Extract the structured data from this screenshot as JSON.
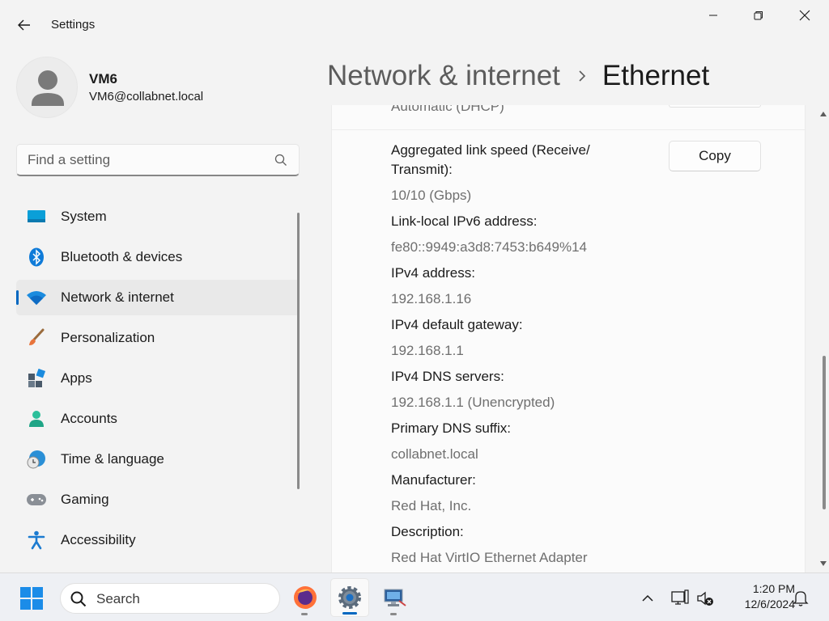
{
  "window": {
    "title": "Settings"
  },
  "user": {
    "name": "VM6",
    "email": "VM6@collabnet.local"
  },
  "search": {
    "placeholder": "Find a setting"
  },
  "nav": {
    "items": [
      {
        "label": "System",
        "icon": "system-icon",
        "active": false
      },
      {
        "label": "Bluetooth & devices",
        "icon": "bluetooth-icon",
        "active": false
      },
      {
        "label": "Network & internet",
        "icon": "wifi-icon",
        "active": true
      },
      {
        "label": "Personalization",
        "icon": "brush-icon",
        "active": false
      },
      {
        "label": "Apps",
        "icon": "apps-icon",
        "active": false
      },
      {
        "label": "Accounts",
        "icon": "accounts-icon",
        "active": false
      },
      {
        "label": "Time & language",
        "icon": "time-language-icon",
        "active": false
      },
      {
        "label": "Gaming",
        "icon": "gamepad-icon",
        "active": false
      },
      {
        "label": "Accessibility",
        "icon": "accessibility-icon",
        "active": false
      }
    ]
  },
  "header": {
    "parent": "Network & internet",
    "current": "Ethernet"
  },
  "properties": {
    "clipped_value": "Automatic (DHCP)",
    "copy_label": "Copy",
    "rows": [
      {
        "label": "Aggregated link speed (Receive/",
        "label_line2": "Transmit):",
        "value": "10/10 (Gbps)"
      },
      {
        "label": "Link-local IPv6 address:",
        "value": "fe80::9949:a3d8:7453:b649%14"
      },
      {
        "label": "IPv4 address:",
        "value": "192.168.1.16"
      },
      {
        "label": "IPv4 default gateway:",
        "value": "192.168.1.1"
      },
      {
        "label": "IPv4 DNS servers:",
        "value": "192.168.1.1 (Unencrypted)"
      },
      {
        "label": "Primary DNS suffix:",
        "value": "collabnet.local"
      },
      {
        "label": "Manufacturer:",
        "value": "Red Hat, Inc."
      },
      {
        "label": "Description:",
        "value": "Red Hat VirtIO Ethernet Adapter"
      }
    ]
  },
  "taskbar": {
    "search_label": "Search",
    "apps": [
      "firefox-icon",
      "settings-icon",
      "network-manager-icon"
    ],
    "time": "1:20 PM",
    "date": "12/6/2024"
  },
  "colors": {
    "accent": "#0067c0",
    "background": "#f3f3f3",
    "panel": "#fbfbfb"
  }
}
